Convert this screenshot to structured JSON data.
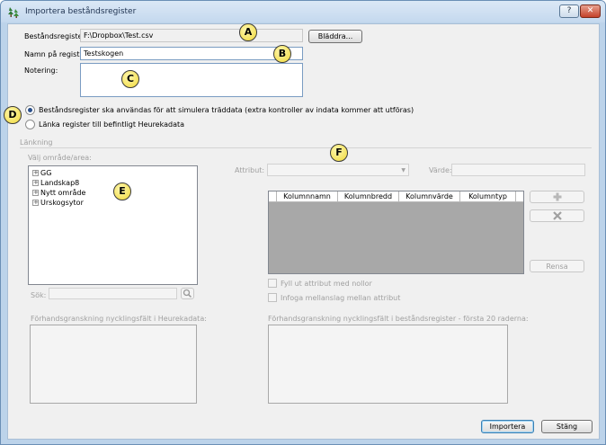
{
  "window": {
    "title": "Importera beståndsregister",
    "help_label": "?",
    "close_label": "✕"
  },
  "file": {
    "label": "Beståndsregisterfil:",
    "value": "F:\\Dropbox\\Test.csv",
    "browse_label": "Bläddra..."
  },
  "name": {
    "label": "Namn på register:",
    "value": "Testskogen"
  },
  "note": {
    "label": "Notering:",
    "value": ""
  },
  "options": {
    "simulate_label": "Beståndsregister ska användas för att simulera träddata (extra kontroller av indata kommer att utföras)",
    "link_label": "Länka register till befintligt Heurekadata",
    "selected": "simulate"
  },
  "linking": {
    "section_label": "Länkning",
    "area_label": "Välj område/area:",
    "tree_items": [
      {
        "label": "GG"
      },
      {
        "label": "Landskap8"
      },
      {
        "label": "Nytt område"
      },
      {
        "label": "Urskogsytor"
      }
    ],
    "search_label": "Sök:",
    "search_value": "",
    "attribute_label": "Attribut:",
    "attribute_value": "",
    "value_label": "Värde:",
    "value_value": "",
    "columns": [
      "Kolumnnamn",
      "Kolumnbredd",
      "Kolumnvärde",
      "Kolumntyp"
    ],
    "clear_label": "Rensa",
    "fill_zeros_label": "Fyll ut attribut med nollor",
    "insert_spaces_label": "Infoga mellanslag mellan attribut",
    "preview_heureka_label": "Förhandsgranskning nycklingsfält i Heurekadata:",
    "preview_register_label": "Förhandsgranskning nycklingsfält i beståndsregister - första 20 raderna:"
  },
  "footer": {
    "import_label": "Importera",
    "close_label": "Stäng"
  },
  "callouts": {
    "a": "A",
    "b": "B",
    "c": "C",
    "d": "D",
    "e": "E",
    "f": "F"
  },
  "colors": {
    "frame": "#bcd3ea",
    "client_bg": "#f0f0f0",
    "callout_fill": "#f0d838",
    "grid_bg": "#a8a8a8",
    "close_button": "#c4412a"
  }
}
